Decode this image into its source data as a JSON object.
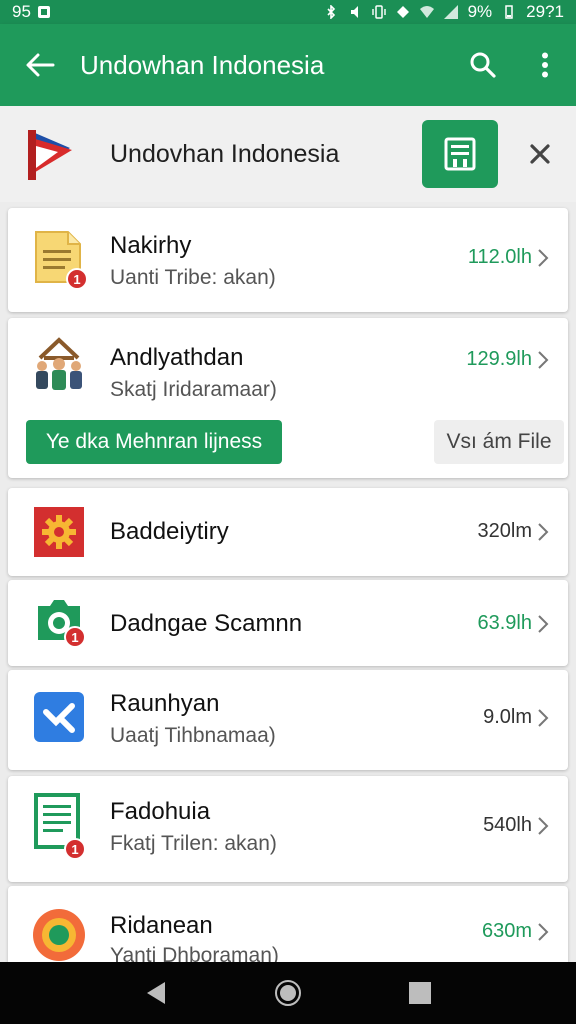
{
  "status_bar": {
    "left_text": "95",
    "battery": "9%",
    "time": "29?1"
  },
  "app_bar": {
    "title": "Undowhan Indonesia"
  },
  "header": {
    "title": "Undovhan Indonesia"
  },
  "items": [
    {
      "name": "Nakirhy",
      "sub": "Uanti Tribe: akan)",
      "size": "112.0lh",
      "badge": "1",
      "size_color": "#1f9a5b"
    },
    {
      "name": "Andlyathdan",
      "sub": "Skatj Iridaramaar)",
      "size": "129.9lh",
      "size_color": "#1f9a5b",
      "action_green": "Ye dka Mehnran lijness",
      "action_grey": "Vsı ám File"
    },
    {
      "name": "Baddeiytiry",
      "size": "320lm",
      "size_color": "#333333"
    },
    {
      "name": "Dadngae Scamnn",
      "size": "63.9lh",
      "badge": "1",
      "size_color": "#1f9a5b"
    },
    {
      "name": "Raunhyan",
      "sub": "Uaatj Tihbnamaa)",
      "size": "9.0lm",
      "size_color": "#333333"
    },
    {
      "name": "Fadohuia",
      "sub": "Fkatj Trilen: akan)",
      "size": "540lh",
      "badge": "1",
      "size_color": "#333333"
    },
    {
      "name": "Ridanean",
      "sub": "Yanti Dhboraman)",
      "size": "630m",
      "size_color": "#1f9a5b"
    }
  ],
  "icons": {
    "back": "arrow-left-icon",
    "search": "search-icon",
    "more": "more-vertical-icon",
    "save": "save-icon",
    "close": "close-icon"
  },
  "colors": {
    "primary": "#1f9a5b",
    "badge": "#d32f2f"
  }
}
